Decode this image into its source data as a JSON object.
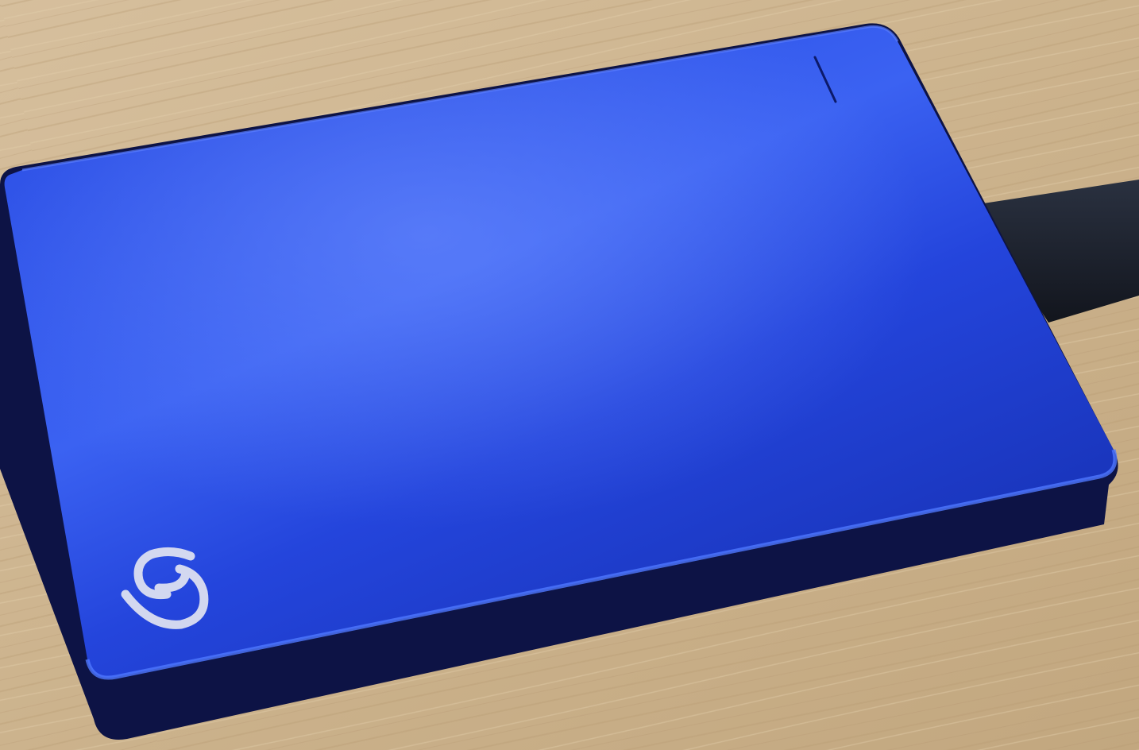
{
  "scene": {
    "subject": "drive",
    "colors": {
      "desk_light": "#d9c3a2",
      "desk_mid": "#c9b08b",
      "desk_dark": "#b39772",
      "drive_body_light": "#3f6bf0",
      "drive_body_mid": "#1f3fd6",
      "drive_body_dark": "#1129a8",
      "drive_base": "#0c1140",
      "cable": "#1a1f2b",
      "logo": "#e6e8f2"
    },
    "icons": [
      "logo-swirl-icon",
      "activity-led-icon"
    ]
  }
}
